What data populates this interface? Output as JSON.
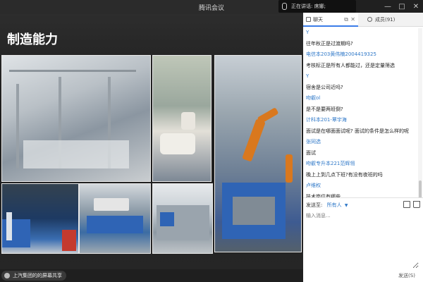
{
  "window": {
    "title": "腾讯会议",
    "speaking_label": "正在讲话: 席娜;",
    "controls": [
      "—",
      "□",
      "✕"
    ]
  },
  "slide": {
    "title": "制造能力"
  },
  "subtitle_bar": {
    "text": "上汽集团的的屏幕共享"
  },
  "chat_panel": {
    "tab_chat": "聊天",
    "tab_chat_popout": "⧉",
    "tab_chat_close": "✕",
    "tab_members": "成员(91)",
    "messages": [
      {
        "kind": "name",
        "text": "Y"
      },
      {
        "kind": "text",
        "text": "往年秋正是过渡期吗?"
      },
      {
        "kind": "name",
        "text": "电信本203黄伟楠2004419325"
      },
      {
        "kind": "text",
        "text": "考核标正是所有人都能过，还是定量筛选"
      },
      {
        "kind": "name",
        "text": "Y"
      },
      {
        "kind": "text",
        "text": "宿舍是公司近吗?"
      },
      {
        "kind": "name",
        "text": "吻叡ol"
      },
      {
        "kind": "text",
        "text": "是不是要两班倒?"
      },
      {
        "kind": "name",
        "text": "计科本201-覃宇海"
      },
      {
        "kind": "text",
        "text": "面试是在哪面面试呢? 面试的条件是怎么样的呢"
      },
      {
        "kind": "name",
        "text": "张同选"
      },
      {
        "kind": "text",
        "text": "面试"
      },
      {
        "kind": "name",
        "text": "吻叡专升本221范辉翎"
      },
      {
        "kind": "text",
        "text": "晚上上到几点下班?有没有夜班的吗"
      },
      {
        "kind": "name",
        "text": "卢维权"
      },
      {
        "kind": "text",
        "text": "技术岗位有哪些"
      }
    ],
    "send_to_label": "发送至:",
    "send_to_target": "所有人",
    "input_placeholder": "输入消息...",
    "send_button": "发送(S)"
  }
}
